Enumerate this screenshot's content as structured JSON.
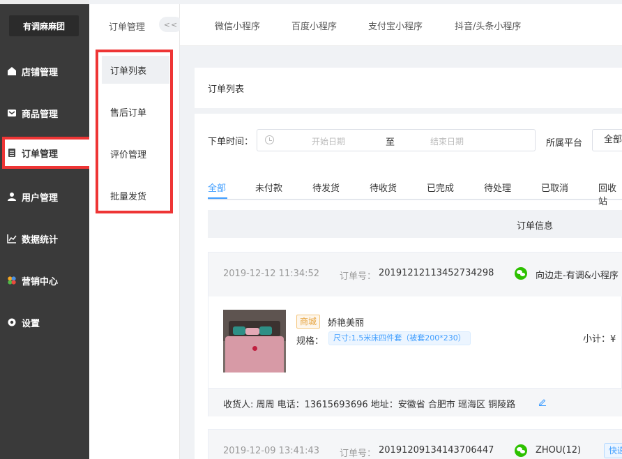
{
  "brand": "有调麻麻团",
  "sidebar": {
    "items": [
      {
        "label": "店铺管理",
        "icon": "store-icon"
      },
      {
        "label": "商品管理",
        "icon": "goods-icon"
      },
      {
        "label": "订单管理",
        "icon": "order-icon",
        "active": true
      },
      {
        "label": "用户管理",
        "icon": "user-icon"
      },
      {
        "label": "数据统计",
        "icon": "chart-icon"
      },
      {
        "label": "营销中心",
        "icon": "marketing-icon"
      },
      {
        "label": "设置",
        "icon": "gear-icon"
      }
    ]
  },
  "subsidebar": {
    "title": "订单管理",
    "collapse": "<<",
    "items": [
      "订单列表",
      "售后订单",
      "评价管理",
      "批量发货"
    ]
  },
  "topbar": {
    "tabs": [
      "微信小程序",
      "百度小程序",
      "支付宝小程序",
      "抖音/头条小程序"
    ]
  },
  "page": {
    "title": "订单列表"
  },
  "filters": {
    "order_time_label": "下单时间：",
    "start_placeholder": "开始日期",
    "range_sep": "至",
    "end_placeholder": "结束日期",
    "platform_label": "所属平台",
    "platform_value": "全部"
  },
  "status_tabs": [
    "全部",
    "未付款",
    "待发货",
    "待收货",
    "已完成",
    "待处理",
    "已取消",
    "回收站"
  ],
  "table": {
    "header": "订单信息"
  },
  "orders": [
    {
      "time": "2019-12-12 11:34:52",
      "order_no_label": "订单号：",
      "order_no": "20191212113452734298",
      "store": "向边走-有调&小程序",
      "badge": "商城",
      "product_name": "娇艳美丽",
      "spec_label": "规格：",
      "spec": "尺寸:1.5米床四件套（被套200*230）",
      "subtotal": "小计：¥",
      "receiver": "收货人: 周周 电话：13615693696 地址：安徽省 合肥市 瑶海区 铜陵路"
    },
    {
      "time": "2019-12-09 13:41:43",
      "order_no_label": "订单号：",
      "order_no": "20191209134143706447",
      "store": "ZHOU(12)",
      "tag": "快递"
    }
  ]
}
